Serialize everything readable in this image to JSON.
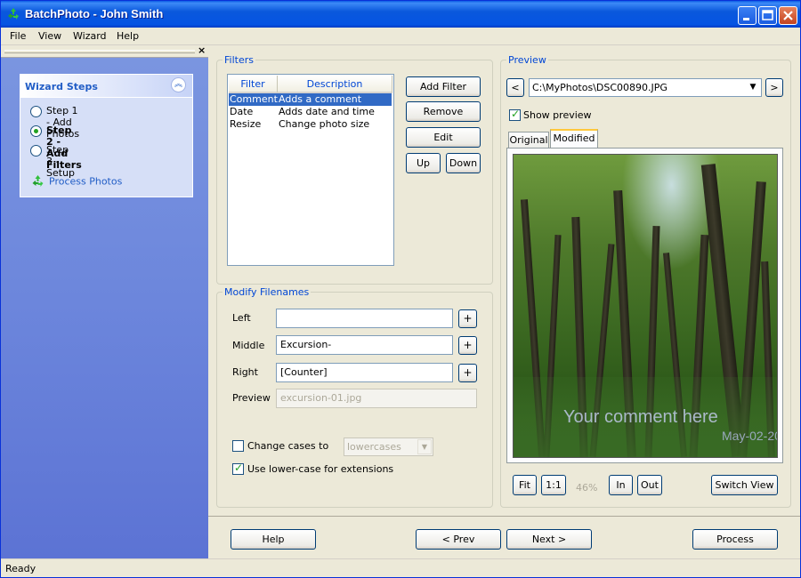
{
  "window": {
    "title": "BatchPhoto - John Smith"
  },
  "menu": [
    "File",
    "View",
    "Wizard",
    "Help"
  ],
  "wizard": {
    "title": "Wizard Steps",
    "steps": [
      {
        "label": "Step 1 - Add Photos",
        "selected": false
      },
      {
        "label": "Step 2 - Add Filters",
        "selected": true
      },
      {
        "label": "Step 3 - Setup",
        "selected": false
      }
    ],
    "process_link": "Process Photos"
  },
  "filters": {
    "group_title": "Filters",
    "columns": [
      "Filter",
      "Description"
    ],
    "rows": [
      {
        "filter": "Comment",
        "description": "Adds a comment",
        "selected": true
      },
      {
        "filter": "Date",
        "description": "Adds date and time",
        "selected": false
      },
      {
        "filter": "Resize",
        "description": "Change photo size",
        "selected": false
      }
    ],
    "buttons": {
      "add": "Add Filter",
      "remove": "Remove",
      "edit": "Edit",
      "up": "Up",
      "down": "Down"
    }
  },
  "modify": {
    "group_title": "Modify Filenames",
    "left_label": "Left",
    "left_value": "",
    "middle_label": "Middle",
    "middle_value": "Excursion-",
    "right_label": "Right",
    "right_value": "[Counter]",
    "preview_label": "Preview",
    "preview_value": "excursion-01.jpg",
    "plus": "+",
    "change_cases_label": "Change cases to",
    "change_cases_checked": false,
    "case_option": "lowercases",
    "lowercase_ext_label": "Use lower-case for extensions",
    "lowercase_ext_checked": true
  },
  "preview": {
    "group_title": "Preview",
    "prev": "<",
    "next": ">",
    "file": "C:\\MyPhotos\\DSC00890.JPG",
    "show_preview_label": "Show preview",
    "show_preview_checked": true,
    "tabs": [
      "Original",
      "Modified"
    ],
    "active_tab": "Modified",
    "overlay_comment": "Your comment here",
    "overlay_date": "May-02-20",
    "zoom": {
      "fit": "Fit",
      "one_to_one": "1:1",
      "percent": "46%",
      "in": "In",
      "out": "Out"
    },
    "switch_view": "Switch View"
  },
  "nav": {
    "help": "Help",
    "prev": "< Prev",
    "next": "Next >",
    "process": "Process"
  },
  "status": "Ready"
}
